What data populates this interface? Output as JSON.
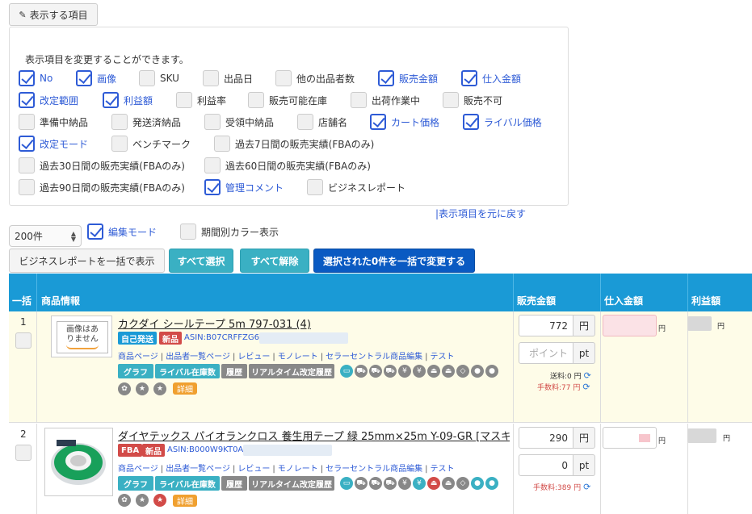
{
  "display_button": {
    "label": "表示する項目",
    "icon": "pencil-icon"
  },
  "settings": {
    "description": "表示項目を変更することができます。",
    "reset_link": "|表示項目を元に戻す",
    "options": [
      {
        "label": "No",
        "checked": true
      },
      {
        "label": "画像",
        "checked": true
      },
      {
        "label": "SKU",
        "checked": false
      },
      {
        "label": "出品日",
        "checked": false
      },
      {
        "label": "他の出品者数",
        "checked": false
      },
      {
        "label": "販売金額",
        "checked": true
      },
      {
        "label": "仕入金額",
        "checked": true
      },
      {
        "label": "改定範囲",
        "checked": true
      },
      {
        "label": "利益額",
        "checked": true
      },
      {
        "label": "利益率",
        "checked": false
      },
      {
        "label": "販売可能在庫",
        "checked": false
      },
      {
        "label": "出荷作業中",
        "checked": false
      },
      {
        "label": "販売不可",
        "checked": false
      },
      {
        "label": "準備中納品",
        "checked": false
      },
      {
        "label": "発送済納品",
        "checked": false
      },
      {
        "label": "受領中納品",
        "checked": false
      },
      {
        "label": "店舗名",
        "checked": false
      },
      {
        "label": "カート価格",
        "checked": true
      },
      {
        "label": "ライバル価格",
        "checked": true
      },
      {
        "label": "改定モード",
        "checked": true
      },
      {
        "label": "ベンチマーク",
        "checked": false
      },
      {
        "label": "過去7日間の販売実績(FBAのみ)",
        "checked": false
      },
      {
        "label": "過去30日間の販売実績(FBAのみ)",
        "checked": false
      },
      {
        "label": "過去60日間の販売実績(FBAのみ)",
        "checked": false
      },
      {
        "label": "過去90日間の販売実績(FBAのみ)",
        "checked": false
      },
      {
        "label": "管理コメント",
        "checked": true
      },
      {
        "label": "ビジネスレポート",
        "checked": false
      }
    ]
  },
  "controls": {
    "per_page": "200件",
    "edit_mode": {
      "label": "編集モード",
      "checked": true
    },
    "period_color": {
      "label": "期間別カラー表示",
      "checked": false
    },
    "bulk_report": "ビジネスレポートを一括で表示",
    "select_all": "すべて選択",
    "deselect_all": "すべて解除",
    "bulk_change": "選択された0件を一括で変更する"
  },
  "table": {
    "headers": {
      "bulk": "一括",
      "product": "商品情報",
      "sale_price": "販売金額",
      "cost": "仕入金額",
      "profit": "利益額"
    },
    "rows": [
      {
        "no": "1",
        "image": "画像はありません",
        "title": "カクダイ シールテープ 5m 797-031 (4)",
        "tags": [
          "自己発送",
          "新品"
        ],
        "asin": "ASIN:B07CRFFZG6",
        "links": [
          "商品ページ",
          "出品者一覧ページ",
          "レビュー",
          "モノレート",
          "セラーセントラル商品編集",
          "テスト"
        ],
        "buttons": [
          "グラフ",
          "ライバル在庫数",
          "履歴",
          "リアルタイム改定履歴"
        ],
        "detail": "詳細",
        "price": "772",
        "price_unit": "円",
        "point_placeholder": "ポイント",
        "point_unit": "pt",
        "shipping": "送料:0 円",
        "fee": "手数料:77 円",
        "cost_unit": "円",
        "profit_unit": "円"
      },
      {
        "no": "2",
        "title": "ダイヤテックス パイオランクロス 養生用テープ 緑 25mm×25m Y-09-GR [マスキ...",
        "tags": [
          "FBA",
          "新品"
        ],
        "asin": "ASIN:B000W9KT0A",
        "links": [
          "商品ページ",
          "出品者一覧ページ",
          "レビュー",
          "モノレート",
          "セラーセントラル商品編集",
          "テスト"
        ],
        "buttons": [
          "グラフ",
          "ライバル在庫数",
          "履歴",
          "リアルタイム改定履歴"
        ],
        "detail": "詳細",
        "price": "290",
        "price_unit": "円",
        "point": "0",
        "point_unit": "pt",
        "fee": "手数料:389 円",
        "cost_unit": "円",
        "profit_unit": "円"
      }
    ]
  },
  "colors": {
    "header": "#1a9ad6",
    "accent": "#2e5bd6",
    "primary": "#0a5ac2",
    "info": "#3ab0c3"
  }
}
